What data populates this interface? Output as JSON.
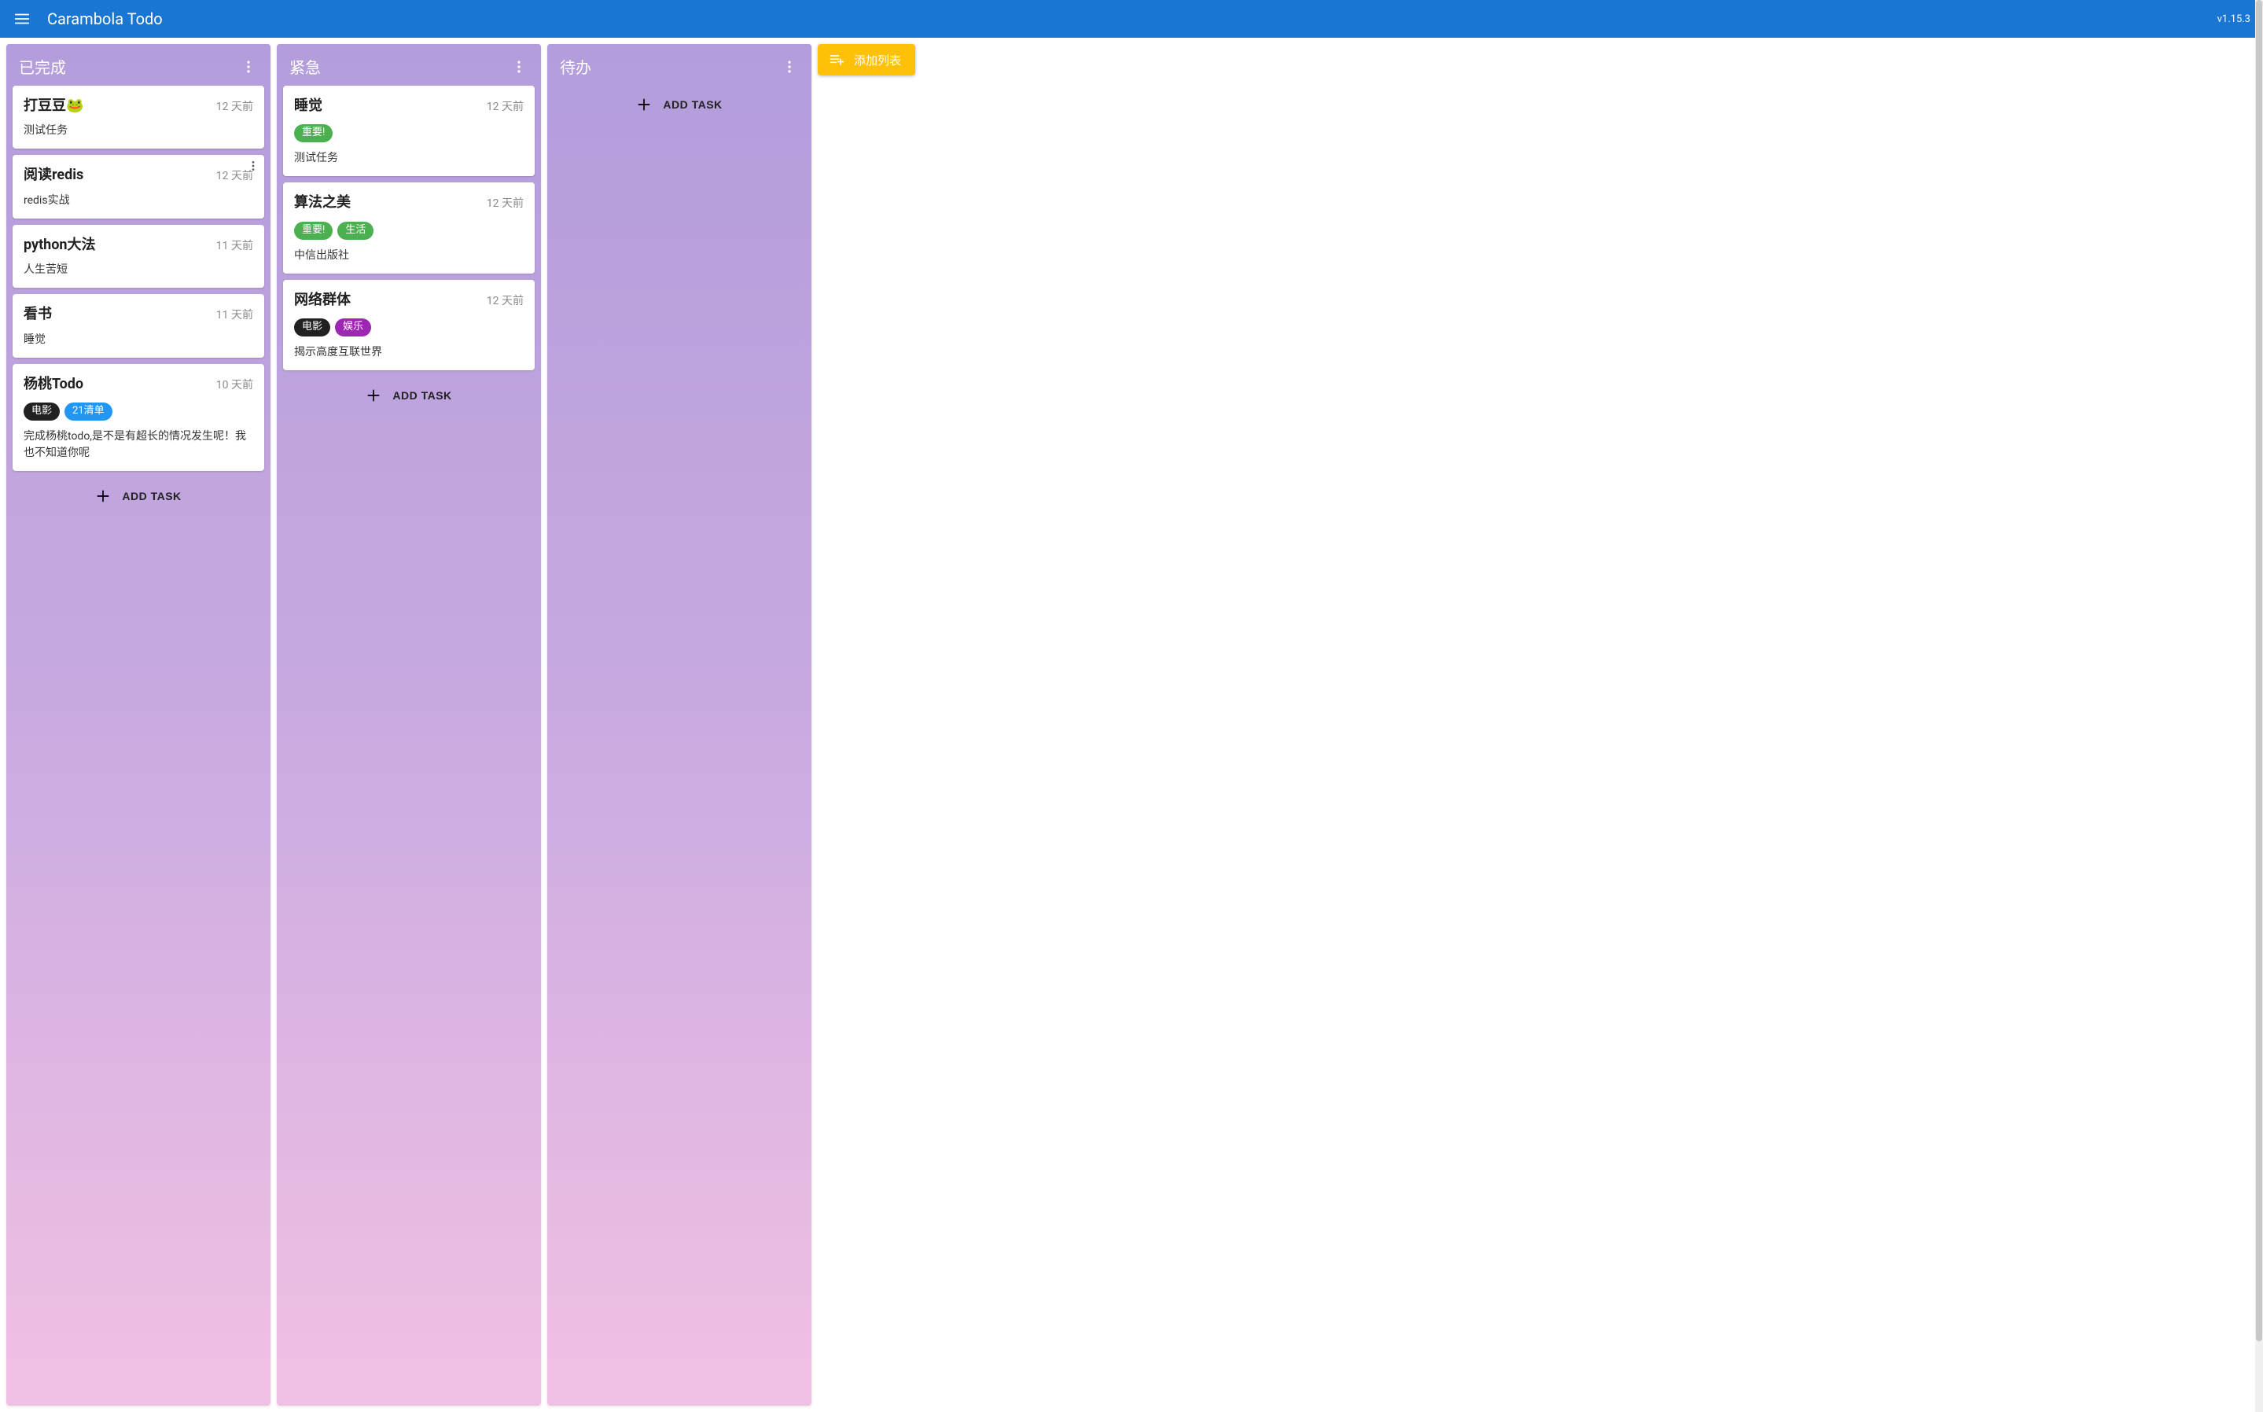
{
  "app": {
    "title": "Carambola Todo",
    "version": "v1.15.3"
  },
  "addListLabel": "添加列表",
  "addTaskLabel": "ADD TASK",
  "tagColors": {
    "重要!": "#4caf50",
    "生活": "#4caf50",
    "电影": "#212121",
    "娱乐": "#9c27b0",
    "21清单": "#2196f3"
  },
  "columns": [
    {
      "title": "已完成",
      "cards": [
        {
          "title": "打豆豆🐸",
          "time": "12 天前",
          "tags": [],
          "desc": "测试任务",
          "showCardMenu": false
        },
        {
          "title": "阅读redis",
          "time": "12 天前",
          "tags": [],
          "desc": "redis实战",
          "showCardMenu": true
        },
        {
          "title": "python大法",
          "time": "11 天前",
          "tags": [],
          "desc": "人生苦短",
          "showCardMenu": false
        },
        {
          "title": "看书",
          "time": "11 天前",
          "tags": [],
          "desc": "睡觉",
          "showCardMenu": false
        },
        {
          "title": "杨桃Todo",
          "time": "10 天前",
          "tags": [
            "电影",
            "21清单"
          ],
          "desc": "完成杨桃todo,是不是有超长的情况发生呢！我也不知道你呢",
          "showCardMenu": false
        }
      ]
    },
    {
      "title": "紧急",
      "cards": [
        {
          "title": "睡觉",
          "time": "12 天前",
          "tags": [
            "重要!"
          ],
          "desc": "测试任务",
          "showCardMenu": false
        },
        {
          "title": "算法之美",
          "time": "12 天前",
          "tags": [
            "重要!",
            "生活"
          ],
          "desc": "中信出版社",
          "showCardMenu": false
        },
        {
          "title": "网络群体",
          "time": "12 天前",
          "tags": [
            "电影",
            "娱乐"
          ],
          "desc": "揭示高度互联世界",
          "showCardMenu": false
        }
      ]
    },
    {
      "title": "待办",
      "cards": []
    }
  ]
}
